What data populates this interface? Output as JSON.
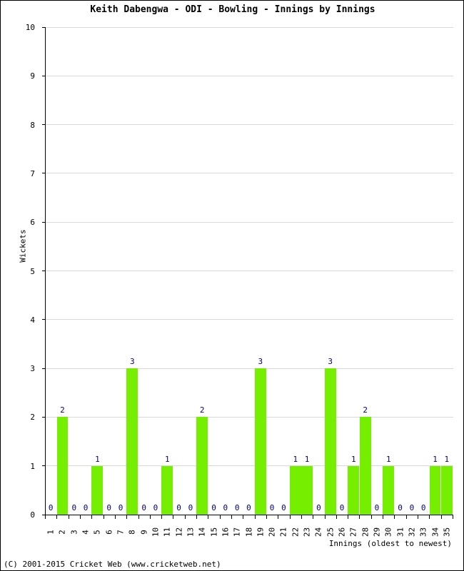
{
  "chart_data": {
    "type": "bar",
    "title": "Keith Dabengwa - ODI - Bowling - Innings by Innings",
    "xlabel": "Innings (oldest to newest)",
    "ylabel": "Wickets",
    "ylim": [
      0,
      10
    ],
    "ytick_labels": [
      "0",
      "1",
      "2",
      "3",
      "4",
      "5",
      "6",
      "7",
      "8",
      "9",
      "10"
    ],
    "ytick_values": [
      0,
      1,
      2,
      3,
      4,
      5,
      6,
      7,
      8,
      9,
      10
    ],
    "grid": true,
    "legend": null,
    "bar_color": "#76ee00",
    "label_color": "#000080",
    "categories": [
      "1",
      "2",
      "3",
      "4",
      "5",
      "6",
      "7",
      "8",
      "9",
      "10",
      "11",
      "12",
      "13",
      "14",
      "15",
      "16",
      "17",
      "18",
      "19",
      "20",
      "21",
      "22",
      "23",
      "24",
      "25",
      "26",
      "27",
      "28",
      "29",
      "30",
      "31",
      "32",
      "33",
      "34",
      "35"
    ],
    "values": [
      0,
      2,
      0,
      0,
      1,
      0,
      0,
      3,
      0,
      0,
      1,
      0,
      0,
      2,
      0,
      0,
      0,
      0,
      3,
      0,
      0,
      1,
      1,
      0,
      3,
      0,
      1,
      2,
      0,
      1,
      0,
      0,
      0,
      1,
      1
    ],
    "point_labels": [
      "0",
      "2",
      "0",
      "0",
      "1",
      "0",
      "0",
      "3",
      "0",
      "0",
      "1",
      "0",
      "0",
      "2",
      "0",
      "0",
      "0",
      "0",
      "3",
      "0",
      "0",
      "1",
      "1",
      "0",
      "3",
      "0",
      "1",
      "2",
      "0",
      "1",
      "0",
      "0",
      "0",
      "1",
      "1"
    ]
  },
  "footer": {
    "credit": "(C) 2001-2015 Cricket Web (www.cricketweb.net)"
  }
}
